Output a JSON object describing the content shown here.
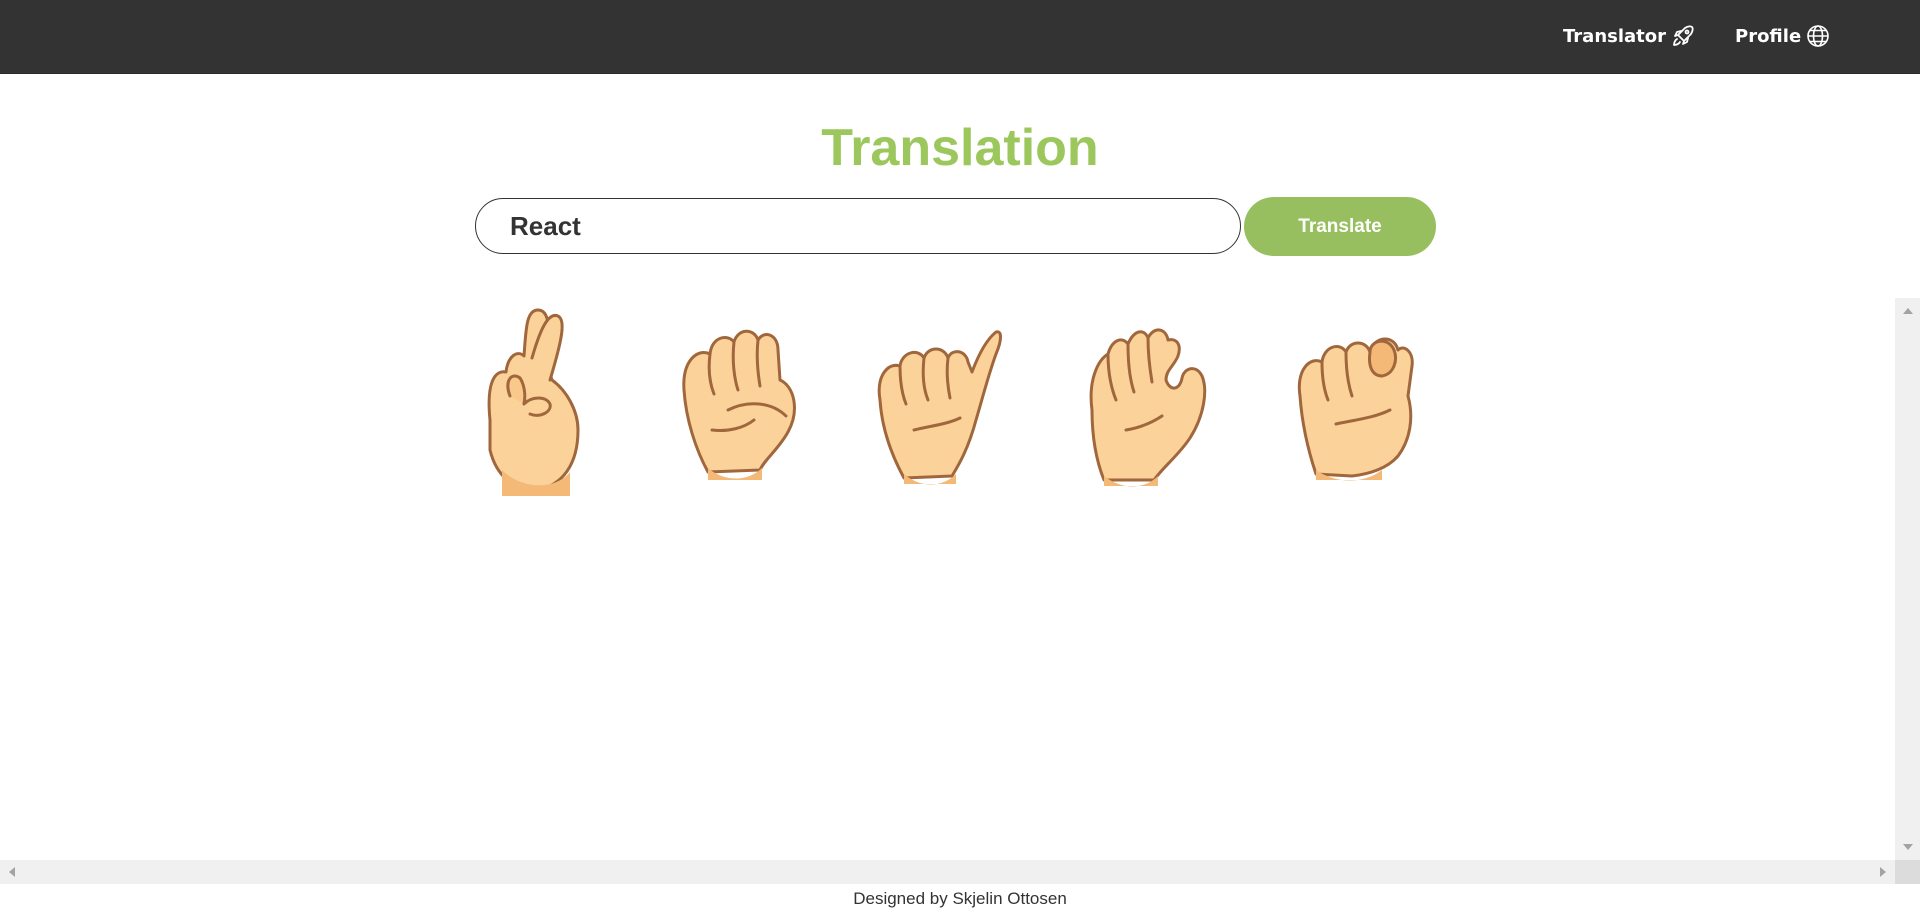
{
  "nav": {
    "translator_label": "Translator",
    "translator_icon": "rocket-icon",
    "profile_label": "Profile",
    "profile_icon": "globe-icon"
  },
  "main": {
    "title": "Translation",
    "input_value": "React",
    "translate_label": "Translate",
    "signs": [
      {
        "letter": "r",
        "icon": "sign-r-hand"
      },
      {
        "letter": "e",
        "icon": "sign-e-hand"
      },
      {
        "letter": "a",
        "icon": "sign-a-hand"
      },
      {
        "letter": "c",
        "icon": "sign-c-hand"
      },
      {
        "letter": "t",
        "icon": "sign-t-hand"
      }
    ]
  },
  "footer": {
    "text": "Designed by Skjelin Ottosen"
  },
  "colors": {
    "navbar": "#333333",
    "accent": "#9cc75c",
    "button": "#98bf5f",
    "skin": "#fcd29b",
    "skin_shadow": "#f4b877",
    "outline": "#a0673d"
  }
}
